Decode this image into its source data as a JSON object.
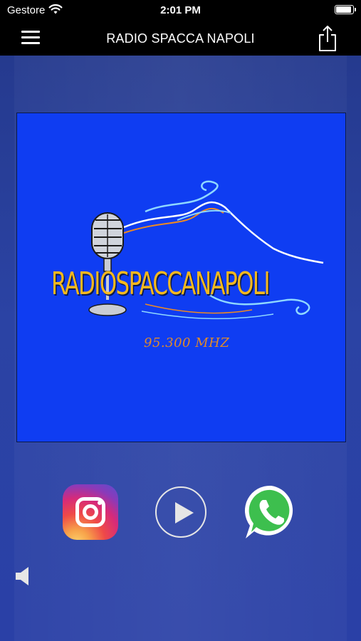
{
  "status_bar": {
    "carrier": "Gestore",
    "time": "2:01 PM"
  },
  "nav": {
    "title": "RADIO SPACCA NAPOLI",
    "menu_icon": "hamburger-menu-icon",
    "share_icon": "share-icon"
  },
  "cover": {
    "brand": "RADIOSPACCANAPOLI",
    "frequency": "95.300 MHZ",
    "background_color": "#0f3df2",
    "brand_color": "#f5b81e",
    "frequency_color": "#e08a2a"
  },
  "controls": {
    "instagram_icon": "instagram-icon",
    "play_icon": "play-icon",
    "whatsapp_icon": "whatsapp-icon"
  },
  "volume_icon": "speaker-icon",
  "colors": {
    "bar_background": "#000000",
    "main_background": "#2b43a4"
  }
}
